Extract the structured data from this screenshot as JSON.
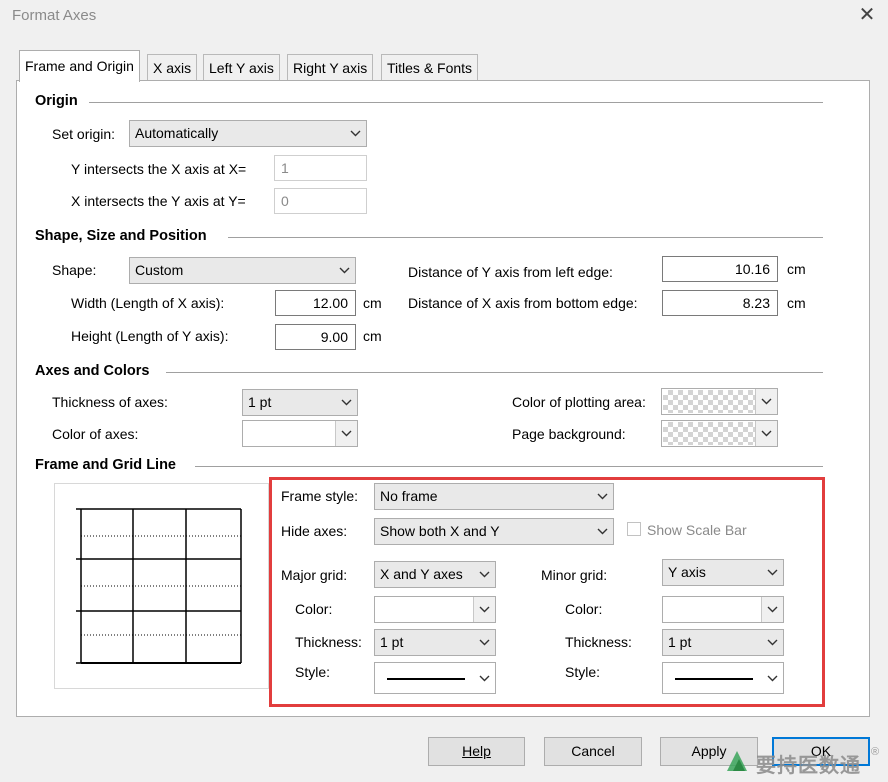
{
  "window": {
    "title": "Format Axes",
    "close_icon": "close-icon"
  },
  "tabs": [
    {
      "label": "Frame and Origin",
      "active": true
    },
    {
      "label": "X axis",
      "active": false
    },
    {
      "label": "Left Y axis",
      "active": false
    },
    {
      "label": "Right Y axis",
      "active": false
    },
    {
      "label": "Titles & Fonts",
      "active": false
    }
  ],
  "origin": {
    "heading": "Origin",
    "set_origin_label": "Set origin:",
    "set_origin_value": "Automatically",
    "y_intersect_label": "Y intersects the X axis at X=",
    "y_intersect_value": "1",
    "x_intersect_label": "X intersects the Y axis at Y=",
    "x_intersect_value": "0"
  },
  "shape": {
    "heading": "Shape, Size and Position",
    "shape_label": "Shape:",
    "shape_value": "Custom",
    "width_label": "Width (Length of X axis):",
    "width_value": "12.00",
    "height_label": "Height (Length of Y axis):",
    "height_value": "9.00",
    "dist_y_label": "Distance of Y axis from left edge:",
    "dist_y_value": "10.16",
    "dist_x_label": "Distance of X axis from bottom edge:",
    "dist_x_value": "8.23",
    "unit": "cm"
  },
  "axes_colors": {
    "heading": "Axes and Colors",
    "thickness_label": "Thickness of axes:",
    "thickness_value": "1 pt",
    "color_label": "Color of axes:",
    "plot_area_label": "Color of plotting area:",
    "page_bg_label": "Page background:"
  },
  "frame_grid": {
    "heading": "Frame and Grid Line",
    "frame_style_label": "Frame style:",
    "frame_style_value": "No frame",
    "hide_axes_label": "Hide axes:",
    "hide_axes_value": "Show both X and Y",
    "show_scale_bar_label": "Show Scale Bar",
    "major_grid_label": "Major grid:",
    "major_grid_value": "X and Y axes",
    "minor_grid_label": "Minor grid:",
    "minor_grid_value": "Y axis",
    "color_label": "Color:",
    "thickness_label": "Thickness:",
    "style_label": "Style:",
    "major_thickness_value": "1 pt",
    "minor_thickness_value": "1 pt"
  },
  "buttons": {
    "help": "Help",
    "cancel": "Cancel",
    "apply": "Apply",
    "ok": "OK"
  },
  "watermark": {
    "text": "要持医数通",
    "mark": "®"
  },
  "highlight_color": "#e23d3d"
}
